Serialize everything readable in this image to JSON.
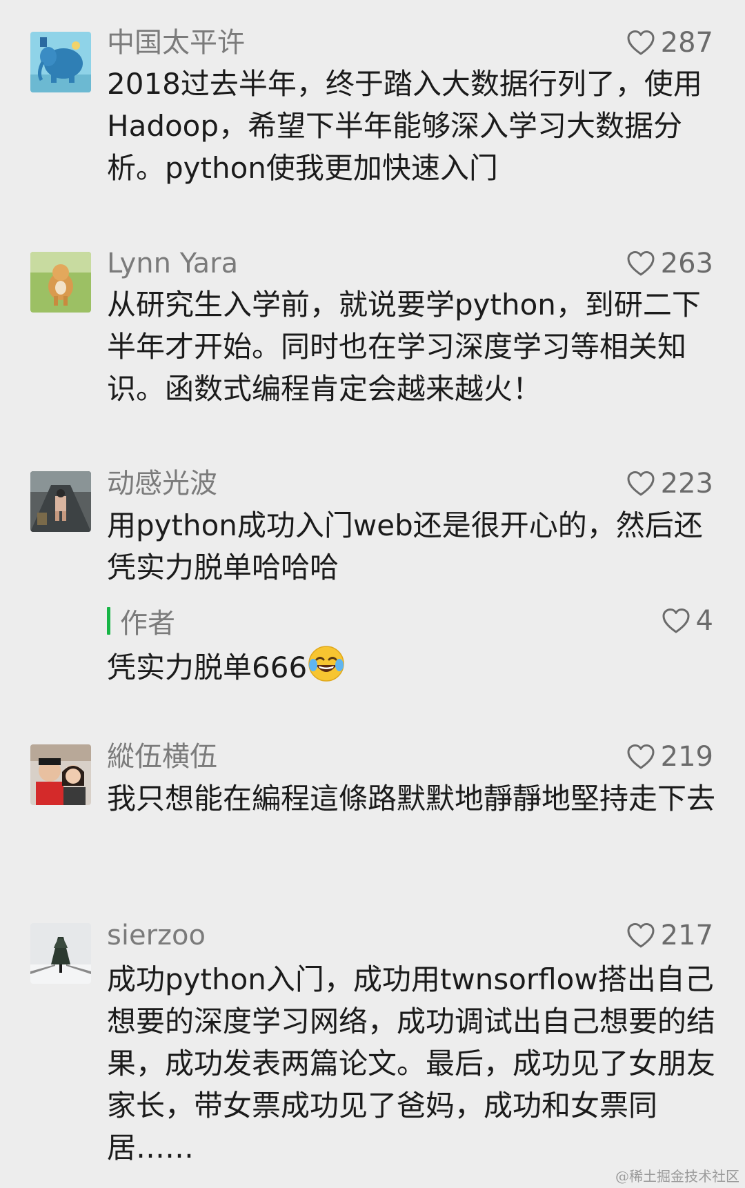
{
  "comments": [
    {
      "username": "中国太平许",
      "likes": "287",
      "text": "2018过去半年，终于踏入大数据行列了，使用Hadoop，希望下半年能够深入学习大数据分析。python使我更加快速入门"
    },
    {
      "username": "Lynn Yara",
      "likes": "263",
      "text": "从研究生入学前，就说要学python，到研二下半年才开始。同时也在学习深度学习等相关知识。函数式编程肯定会越来越火！"
    },
    {
      "username": "动感光波",
      "likes": "223",
      "text": "用python成功入门web还是很开心的，然后还凭实力脱单哈哈哈",
      "reply": {
        "label": "作者",
        "likes": "4",
        "text": "凭实力脱单666"
      }
    },
    {
      "username": "縱伍横伍",
      "likes": "219",
      "text": "我只想能在編程這條路默默地靜靜地堅持走下去"
    },
    {
      "username": "sierzoo",
      "likes": "217",
      "text": "成功python入门，成功用twnsorflow搭出自己想要的深度学习网络，成功调试出自己想要的结果，成功发表两篇论文。最后，成功见了女朋友家长，带女票成功见了爸妈，成功和女票同居……"
    }
  ],
  "watermark": "@稀土掘金技术社区",
  "colors": {
    "background": "#ededed",
    "reply_bar": "#17b546",
    "username": "#7b7b7b"
  }
}
